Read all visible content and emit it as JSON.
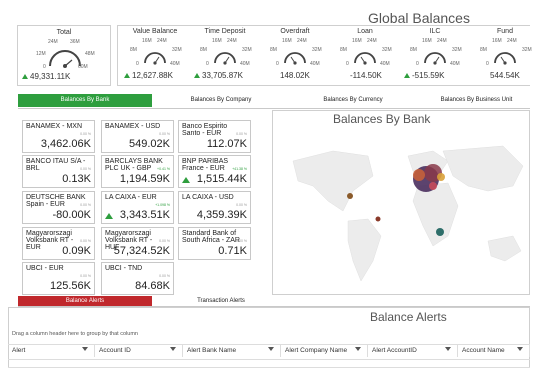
{
  "global_title": "Global Balances",
  "total": {
    "title": "Total",
    "labels": [
      "24M",
      "36M",
      "12M",
      "48M",
      "0",
      "60M"
    ],
    "value": "49,331.11K"
  },
  "gauges": [
    {
      "title": "Value Balance",
      "l1": "16M",
      "l2": "24M",
      "l3": "8M",
      "l4": "32M",
      "l5": "0",
      "l6": "40M",
      "value": "12,627.88K",
      "trend": "up"
    },
    {
      "title": "Time Deposit",
      "l1": "16M",
      "l2": "24M",
      "l3": "8M",
      "l4": "32M",
      "l5": "0",
      "l6": "40M",
      "value": "33,705.87K",
      "trend": "up"
    },
    {
      "title": "Overdraft",
      "l1": "16M",
      "l2": "24M",
      "l3": "8M",
      "l4": "32M",
      "l5": "0",
      "l6": "40M",
      "value": "148.02K",
      "trend": "none"
    },
    {
      "title": "Loan",
      "l1": "16M",
      "l2": "24M",
      "l3": "8M",
      "l4": "32M",
      "l5": "0",
      "l6": "40M",
      "value": "-114.50K",
      "trend": "none"
    },
    {
      "title": "ILC",
      "l1": "16M",
      "l2": "24M",
      "l3": "8M",
      "l4": "32M",
      "l5": "0",
      "l6": "40M",
      "value": "-515.59K",
      "trend": "up"
    },
    {
      "title": "Fund",
      "l1": "16M",
      "l2": "24M",
      "l3": "8M",
      "l4": "32M",
      "l5": "0",
      "l6": "",
      "value": "544.54K",
      "trend": "none"
    }
  ],
  "tabs": [
    {
      "label": "Balances By Bank"
    },
    {
      "label": "Balances By Company"
    },
    {
      "label": "Balances By Currency"
    },
    {
      "label": "Balances By Business Unit"
    }
  ],
  "map_title": "Balances By Bank",
  "cards": [
    {
      "name": "BANAMEX - MXN",
      "pct": "0.00 %",
      "value": "3,462.06K"
    },
    {
      "name": "BANAMEX - USD",
      "pct": "0.00 %",
      "value": "549.02K"
    },
    {
      "name": "Banco Espirito Santo - EUR",
      "pct": "0.00 %",
      "value": "112.07K"
    },
    {
      "name": "BANCO ITAU S/A - BRL",
      "pct": "0.00 %",
      "value": "0.13K"
    },
    {
      "name": "BARCLAYS BANK PLC UK - GBP",
      "pct": "+0.41 %",
      "value": "1,194.59K"
    },
    {
      "name": "BNP PARIBAS France - EUR",
      "pct": "+41.38 %",
      "value": "1,515.44K"
    },
    {
      "name": "DEUTSCHE BANK Spain - EUR",
      "pct": "0.00 %",
      "value": "-80.00K"
    },
    {
      "name": "LA CAIXA - EUR",
      "pct": "+1.098 %",
      "value": "3,343.51K"
    },
    {
      "name": "LA CAIXA - USD",
      "pct": "0.00 %",
      "value": "4,359.39K"
    },
    {
      "name": "Magyarorszagi Volksbank RT - EUR",
      "pct": "0.00 %",
      "value": "0.09K"
    },
    {
      "name": "Magyarorszagi Volksbank RT - HUF",
      "pct": "0.00 %",
      "value": "57,324.52K"
    },
    {
      "name": "Standard Bank of South Africa - ZAR",
      "pct": "0.00 %",
      "value": "0.71K"
    },
    {
      "name": "UBCI - EUR",
      "pct": "0.00 %",
      "value": "125.56K"
    },
    {
      "name": "UBCI - TND",
      "pct": "0.00 %",
      "value": "84.68K"
    }
  ],
  "alert_tabs": [
    {
      "label": "Balance Alerts"
    },
    {
      "label": "Transaction Alerts"
    }
  ],
  "alerts_title": "Balance Alerts",
  "group_hint": "Drag a column header here to group by that column",
  "columns": [
    "Alert",
    "Account ID",
    "Alert Bank Name",
    "Alert Company Name",
    "Alert AccountID",
    "Account Name"
  ],
  "colors": {
    "accent_green": "#2e9e3e",
    "accent_red": "#c0282c"
  }
}
